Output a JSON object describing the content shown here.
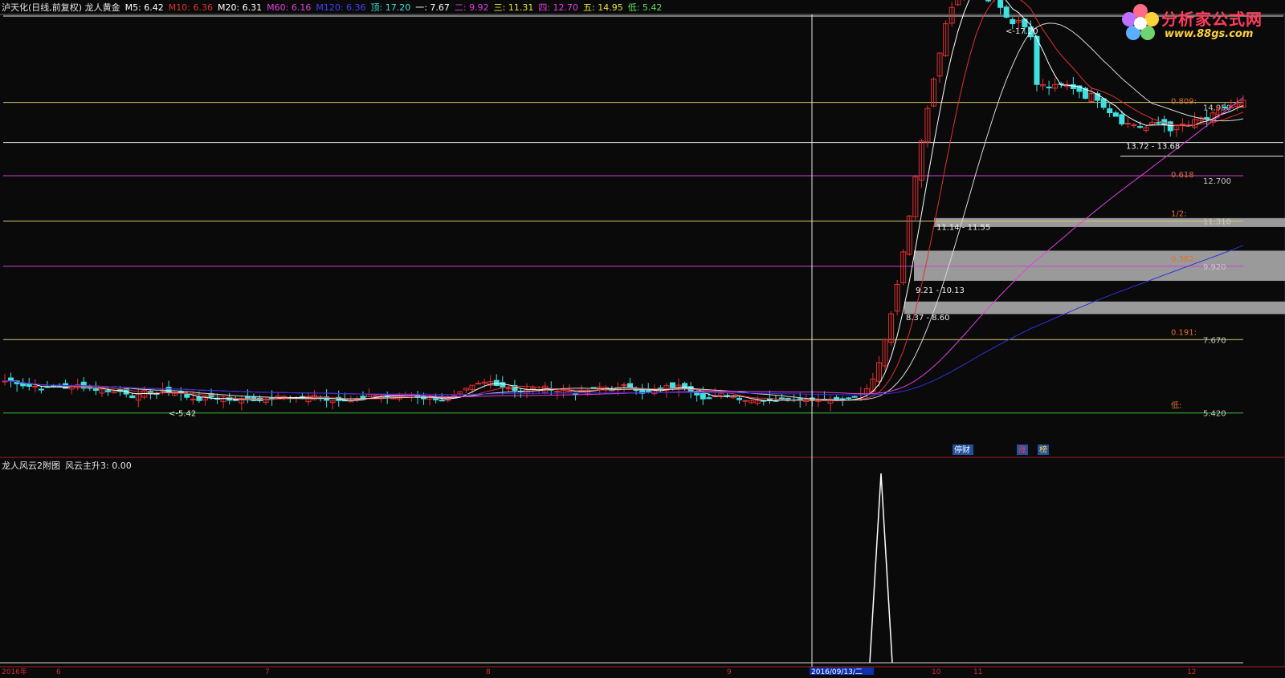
{
  "header": {
    "items": [
      {
        "text": "泸天化(日线,前复权) 龙人黄金",
        "color": "#e6e6e6"
      },
      {
        "text": "M5: 6.42",
        "color": "#ffffff"
      },
      {
        "text": "M10: 6.36",
        "color": "#e03030"
      },
      {
        "text": "M20: 6.31",
        "color": "#ffffff"
      },
      {
        "text": "M60: 6.16",
        "color": "#e040e0"
      },
      {
        "text": "M120: 6.36",
        "color": "#4040ff"
      },
      {
        "text": "顶: 17.20",
        "color": "#40e0e0"
      },
      {
        "text": "一: 7.67",
        "color": "#ffffff"
      },
      {
        "text": "二: 9.92",
        "color": "#e040e0"
      },
      {
        "text": "三: 11.31",
        "color": "#e6e640"
      },
      {
        "text": "四: 12.70",
        "color": "#e040e0"
      },
      {
        "text": "五: 14.95",
        "color": "#e6e640"
      },
      {
        "text": "低: 5.42",
        "color": "#60e060"
      }
    ]
  },
  "subheader": {
    "items": [
      {
        "text": "龙人风云2附图",
        "color": "#e6e6e6"
      },
      {
        "text": "风云主升3: 0.00",
        "color": "#e6e6e6"
      }
    ]
  },
  "logo": {
    "title": "分析家公式网",
    "url": "www.88gs.com"
  },
  "chart_data": [
    {
      "type": "candlestick",
      "title": "泸天化(日线,前复权) 龙人黄金",
      "y_ticks_right": [
        {
          "ratio_label": "0.809:",
          "value_label": "14.950",
          "value": 14.95
        },
        {
          "ratio_label": "0.618",
          "value_label": "12.700",
          "value": 12.7
        },
        {
          "ratio_label": "1/2:",
          "value_label": "11.310",
          "value": 11.31
        },
        {
          "ratio_label": "0.382:",
          "value_label": "9.920",
          "value": 9.92
        },
        {
          "ratio_label": "0.191:",
          "value_label": "7.670",
          "value": 7.67
        },
        {
          "ratio_label": "低:",
          "value_label": "5.420",
          "value": 5.42
        }
      ],
      "high_marker": "<-17.20",
      "low_marker": "<-5.42",
      "zone_labels": [
        "13.72 - 13.68",
        "11.14 - 11.55",
        "9.21 - 10.13",
        "8.37 - 8.60"
      ],
      "badges": [
        "停财",
        "涨",
        "榜"
      ],
      "x_ticks": [
        "2016年",
        "6",
        "7",
        "8",
        "9",
        "2016/09/13/二",
        "10",
        "11",
        "12"
      ],
      "ylim": [
        4.6,
        17.6
      ],
      "colors": {
        "up": "#e03030",
        "down": "#40e0e0",
        "m5": "#ffffff",
        "m10": "#e03030",
        "m60": "#e040e0",
        "m120": "#3030e0"
      }
    },
    {
      "type": "line",
      "title": "龙人风云2附图",
      "series": [
        {
          "name": "风云主升3",
          "current": 0.0
        }
      ],
      "spike": {
        "at": "10",
        "value": 1
      }
    }
  ]
}
